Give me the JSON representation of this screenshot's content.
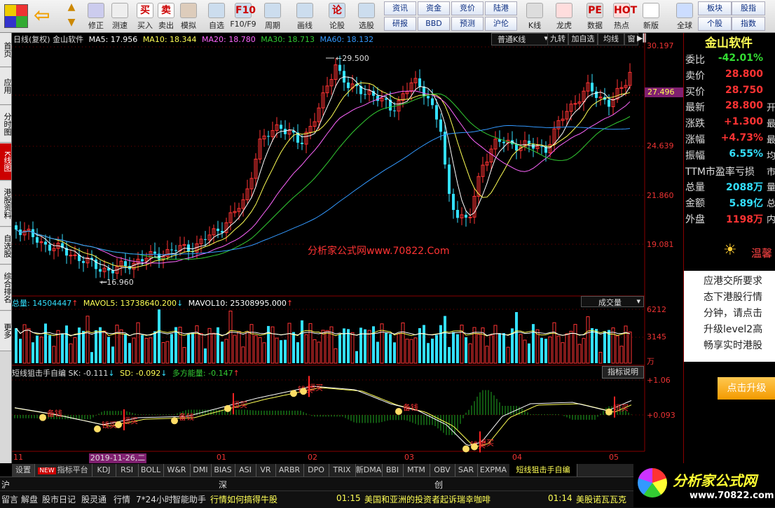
{
  "toolbar": {
    "buttons": [
      {
        "label": "修正",
        "icon": "refresh-icon"
      },
      {
        "label": "测速",
        "icon": "speed-icon"
      },
      {
        "label": "买入",
        "icon": "buy-icon"
      },
      {
        "label": "卖出",
        "icon": "sell-icon"
      },
      {
        "label": "模拟",
        "icon": "gavel-icon"
      },
      {
        "label": "自选",
        "icon": "favorite-icon"
      },
      {
        "label": "F10/F9",
        "icon": "f10-icon"
      },
      {
        "label": "周期",
        "icon": "period-icon"
      },
      {
        "label": "画线",
        "icon": "draw-icon"
      },
      {
        "label": "论股",
        "icon": "forum-icon"
      },
      {
        "label": "选股",
        "icon": "stock-pick-icon"
      },
      {
        "label": "K线",
        "icon": "kline-icon"
      },
      {
        "label": "龙虎",
        "icon": "dragon-icon"
      },
      {
        "label": "数据",
        "icon": "data-icon"
      },
      {
        "label": "热点",
        "icon": "hot-icon"
      },
      {
        "label": "新版",
        "icon": "new-version-icon"
      },
      {
        "label": "全球",
        "icon": "globe-icon"
      }
    ],
    "icon_glyphs": {
      "buy": "买",
      "sell": "卖",
      "f10": "F10",
      "forum": "论",
      "data": "PE",
      "hot": "HOT"
    },
    "grid_top": [
      "资讯",
      "资金",
      "竞价",
      "陆港"
    ],
    "grid_bottom": [
      "研报",
      "BBD",
      "预测",
      "沪伦"
    ],
    "right_top": [
      "板块",
      "股指"
    ],
    "right_bottom": [
      "个股",
      "指数"
    ]
  },
  "leftbar": [
    "首页",
    "应用",
    "分时图",
    "K线图",
    "港股资料",
    "自选股",
    "综合排名",
    "更多"
  ],
  "chart": {
    "info_name": "日线(复权) 金山软件",
    "ma5": "MA5: 17.956",
    "ma10": "MA10: 18.344",
    "ma20": "MA20: 18.780",
    "ma30": "MA30: 18.713",
    "ma60": "MA60: 18.132",
    "mode_select": "普通K线",
    "btns": [
      "九转",
      "加自选",
      "均线",
      "窗"
    ],
    "y_labels": [
      "30.197",
      "27.496",
      "24.639",
      "21.860",
      "19.081"
    ],
    "high_label": "29.500",
    "low_label": "16.960",
    "watermark": "分析家公式网www.70822.Com",
    "vol_header": "总量: 14504447",
    "mavol5": "MAVOL5: 13738640.200",
    "mavol10": "MAVOL10: 25308995.000",
    "vol_select": "成交量",
    "vol_y": [
      "6212",
      "3145",
      "万"
    ],
    "ind_header": "短线狙击手自编 SK: -0.111",
    "ind_sd": "SD: -0.092",
    "ind_duo": "多方能量: -0.147",
    "ind_btn": "指标说明",
    "ind_y": [
      "+1.06",
      "+0.093"
    ],
    "signal_texts": [
      "备钱",
      "短买",
      "钱买"
    ],
    "x_labels": [
      "11",
      "01",
      "02",
      "03",
      "04",
      "05"
    ],
    "cursor_date": "2019-11-26,二",
    "colors": {
      "up": "#ff3333",
      "down": "#33e0ff",
      "ma5": "#ffffff",
      "ma10": "#ffff55",
      "ma20": "#ff66ff",
      "ma30": "#33cc33",
      "ma60": "#3399ff"
    }
  },
  "quote": {
    "name": "金山软件",
    "rows": [
      {
        "k": "委比",
        "v": "-42.01%",
        "c": "#33dd33",
        "t": ""
      },
      {
        "k": "卖价",
        "v": "28.800",
        "c": "#ff3333",
        "t": ""
      },
      {
        "k": "买价",
        "v": "28.750",
        "c": "#ff3333",
        "t": ""
      },
      {
        "k": "最新",
        "v": "28.800",
        "c": "#ff3333",
        "t": "开"
      },
      {
        "k": "涨跌",
        "v": "+1.300",
        "c": "#ff3333",
        "t": "最"
      },
      {
        "k": "涨幅",
        "v": "+4.73%",
        "c": "#ff3333",
        "t": "最"
      },
      {
        "k": "振幅",
        "v": "6.55%",
        "c": "#33e0ff",
        "t": "均"
      },
      {
        "k": "TTM市盈率亏损",
        "v": "",
        "c": "#ff3333",
        "t": "市"
      },
      {
        "k": "总量",
        "v": "2088万",
        "c": "#33e0ff",
        "t": "量"
      },
      {
        "k": "金额",
        "v": "5.89亿",
        "c": "#33e0ff",
        "t": "总"
      },
      {
        "k": "外盘",
        "v": "1198万",
        "c": "#ff3333",
        "t": "内"
      }
    ],
    "bulb_label": "温馨",
    "notice": [
      "应港交所要求",
      "态下港股行情",
      "分钟，请点击",
      "升级level2高",
      "畅享实时港股"
    ],
    "upgrade_btn": "点击升级"
  },
  "tabs": [
    "设置",
    "指标平台",
    "KDJ",
    "RSI",
    "BOLL",
    "W&R",
    "DMI",
    "BIAS",
    "ASI",
    "VR",
    "ARBR",
    "DPO",
    "TRIX",
    "新DMA",
    "BBI",
    "MTM",
    "OBV",
    "SAR",
    "EXPMA",
    "短线狙击手自编"
  ],
  "tabs_new": "NEW",
  "status": [
    "沪",
    "深",
    "创"
  ],
  "ticker": {
    "items": [
      "留言",
      "解盘",
      "股市日记",
      "股灵通",
      "行情",
      "7*24小时",
      "智能助手"
    ],
    "headline1": "行情如何搞得牛股",
    "news1_time": "01:15",
    "news1": "美国和亚洲的投资者起诉瑞幸咖啡",
    "news2_time": "01:14",
    "news2": "美股诺瓦瓦克"
  },
  "logo": {
    "text": "分析家公式网",
    "url": "www.70822.com"
  }
}
